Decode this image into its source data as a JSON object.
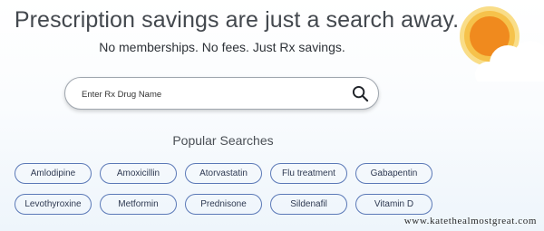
{
  "hero": {
    "headline": "Prescription savings are just a search away.",
    "subheadline": "No memberships. No fees. Just Rx savings."
  },
  "search": {
    "placeholder": "Enter Rx Drug Name",
    "icon": "search-icon"
  },
  "popular": {
    "title": "Popular Searches",
    "row1": [
      "Amlodipine",
      "Amoxicillin",
      "Atorvastatin",
      "Flu treatment",
      "Gabapentin"
    ],
    "row2": [
      "Levothyroxine",
      "Metformin",
      "Prednisone",
      "Sildenafil",
      "Vitamin D"
    ]
  },
  "decoration": {
    "sun_icon": "sun-icon",
    "cloud_icon": "cloud-icon",
    "sun_color": "#f08a1e",
    "sun_ring_color": "#f6c24b"
  },
  "watermark": "www.katethealmostgreat.com",
  "colors": {
    "pill_border": "#5b79b7",
    "text": "#43484e"
  }
}
